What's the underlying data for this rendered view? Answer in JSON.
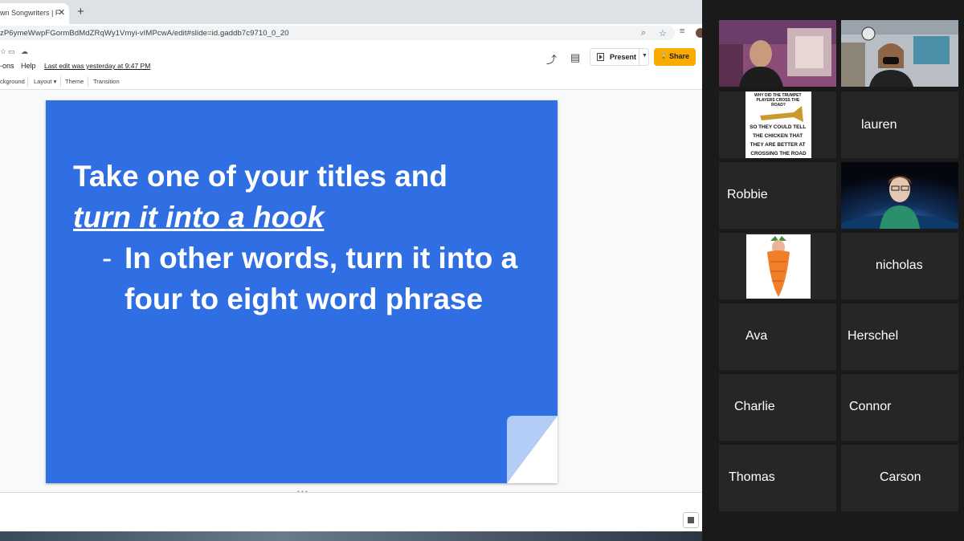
{
  "browser": {
    "tab_title": "wn Songwriters | F",
    "tab_close": "✕",
    "new_tab": "+",
    "url": "zP6ymeWwpFGormBdMdZRqWy1Vmyi-vIMPcwA/edit#slide=id.gaddb7c9710_0_20"
  },
  "docs": {
    "menu": [
      "-ons",
      "Help"
    ],
    "last_edit": "Last edit was yesterday at 9:47 PM",
    "present_label": "Present",
    "share_label": "Share",
    "toolbar": [
      "ckground",
      "Layout ▾",
      "Theme",
      "Transition"
    ]
  },
  "slide": {
    "title_line1": "Take one of your titles and",
    "title_line2": "turn it into a hook",
    "bullet_dash": "-",
    "bullet_text": "In other words, turn it into a four to eight word phrase",
    "background": "#2f6fe3"
  },
  "meme": {
    "top": "WHY DID THE TRUMPET PLAYERS CROSS THE ROAD?",
    "bottom": "SO THEY COULD TELL THE CHICKEN THAT THEY ARE BETTER AT CROSSING THE ROAD"
  },
  "participants": [
    {
      "name": "lauren"
    },
    {
      "name": "Robbie"
    },
    {
      "name": "nicholas"
    },
    {
      "name": "Ava"
    },
    {
      "name": "Herschel"
    },
    {
      "name": "Charlie"
    },
    {
      "name": "Connor"
    },
    {
      "name": "Thomas"
    },
    {
      "name": "Carson"
    }
  ],
  "colors": {
    "accent_share": "#f9ab00",
    "active_speaker_border": "#cfe26b",
    "tile_bg": "#262626"
  }
}
